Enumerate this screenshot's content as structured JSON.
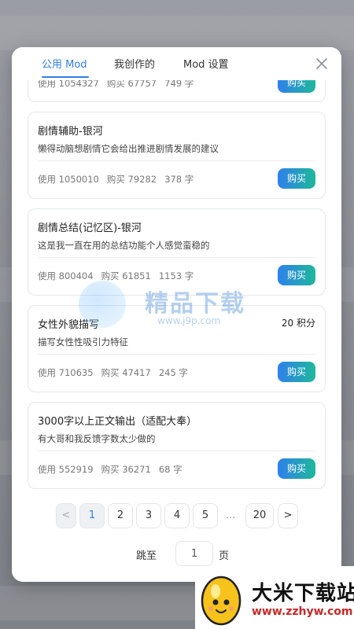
{
  "tabs": [
    {
      "label": "公用 Mod",
      "active": true
    },
    {
      "label": "我创作的",
      "active": false
    },
    {
      "label": "Mod 设置",
      "active": false
    }
  ],
  "partial_card": {
    "stats": [
      "使用 1054327",
      "购买 67757",
      "749 字"
    ],
    "buy_label": "购买"
  },
  "cards": [
    {
      "title": "剧情辅助-银河",
      "price": "",
      "desc": "懒得动脑想剧情它会给出推进剧情发展的建议",
      "uses": "使用 1050010",
      "buys": "购买 79282",
      "words": "378 字",
      "buy_label": "购买"
    },
    {
      "title": "剧情总结(记忆区)-银河",
      "price": "",
      "desc": "这是我一直在用的总结功能个人感觉蛮稳的",
      "uses": "使用 800404",
      "buys": "购买 61851",
      "words": "1153 字",
      "buy_label": "购买"
    },
    {
      "title": "女性外貌描写",
      "price": "20 积分",
      "desc": "描写女性性吸引力特征",
      "uses": "使用 710635",
      "buys": "购买 47417",
      "words": "245 字",
      "buy_label": "购买"
    },
    {
      "title": "3000字以上正文输出（适配大奉）",
      "price": "",
      "desc": "有大哥和我反馈字数太少做的",
      "uses": "使用 552919",
      "buys": "购买 36271",
      "words": "68 字",
      "buy_label": "购买"
    }
  ],
  "pagination": {
    "prev": "<",
    "pages": [
      "1",
      "2",
      "3",
      "4",
      "5"
    ],
    "current": "1",
    "ellipsis": "...",
    "last": "20",
    "next": ">"
  },
  "jump": {
    "prefix": "跳至",
    "value": "1",
    "suffix": "页"
  },
  "watermark": {
    "text": "精品下载",
    "sub": "www.j9p.com"
  },
  "brand": {
    "name": "大米下载站",
    "url": "www.zzhyw.com"
  },
  "colors": {
    "accent": "#2f7fe6",
    "buy_gradient_start": "#2f80ed",
    "buy_gradient_end": "#1eb89a"
  },
  "icons": {
    "close": "close-icon"
  }
}
